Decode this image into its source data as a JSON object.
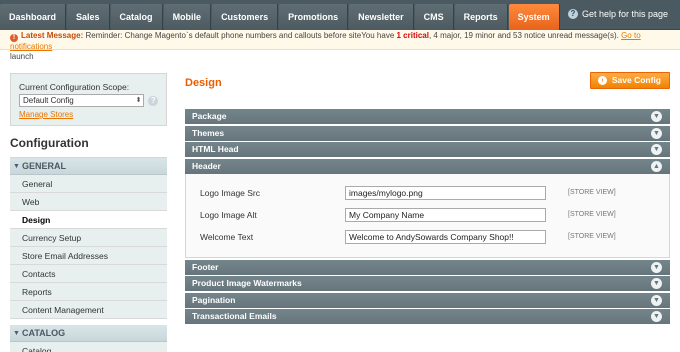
{
  "nav": {
    "items": [
      "Dashboard",
      "Sales",
      "Catalog",
      "Mobile",
      "Customers",
      "Promotions",
      "Newsletter",
      "CMS",
      "Reports",
      "System"
    ],
    "active": "System",
    "help": "Get help for this page"
  },
  "notice": {
    "label": "Latest Message:",
    "text1": " Reminder: Change Magento`s default phone numbers and callouts before site",
    "text2": "You have ",
    "critical_count": "1",
    "critical_word": " critical",
    "rest": ", 4 major, 19 minor and 53 notice unread message(s). ",
    "link": "Go to notifications",
    "line2": "launch"
  },
  "sidebar": {
    "scope_label": "Current Configuration Scope:",
    "scope_value": "Default Config",
    "manage_stores": "Manage Stores",
    "config_title": "Configuration",
    "general_head": "GENERAL",
    "items": [
      "General",
      "Web",
      "Design",
      "Currency Setup",
      "Store Email Addresses",
      "Contacts",
      "Reports",
      "Content Management"
    ],
    "active_item": "Design",
    "catalog_head": "CATALOG",
    "catalog_first": "Catalog"
  },
  "main": {
    "title": "Design",
    "save_label": "Save Config",
    "sections_top": [
      "Package",
      "Themes",
      "HTML Head",
      "Header"
    ],
    "sections_bottom": [
      "Footer",
      "Product Image Watermarks",
      "Pagination",
      "Transactional Emails"
    ],
    "expanded": "Header",
    "fields": [
      {
        "label": "Logo Image Src",
        "value": "images/mylogo.png",
        "scope": "[STORE VIEW]"
      },
      {
        "label": "Logo Image Alt",
        "value": "My Company Name",
        "scope": "[STORE VIEW]"
      },
      {
        "label": "Welcome Text",
        "value": "Welcome to AndySowards Company Shop!!",
        "scope": "[STORE VIEW]"
      }
    ]
  },
  "colors": {
    "accent": "#eb5e00",
    "nav_bg": "#4b5a60",
    "section_bg": "#6e7e85"
  }
}
